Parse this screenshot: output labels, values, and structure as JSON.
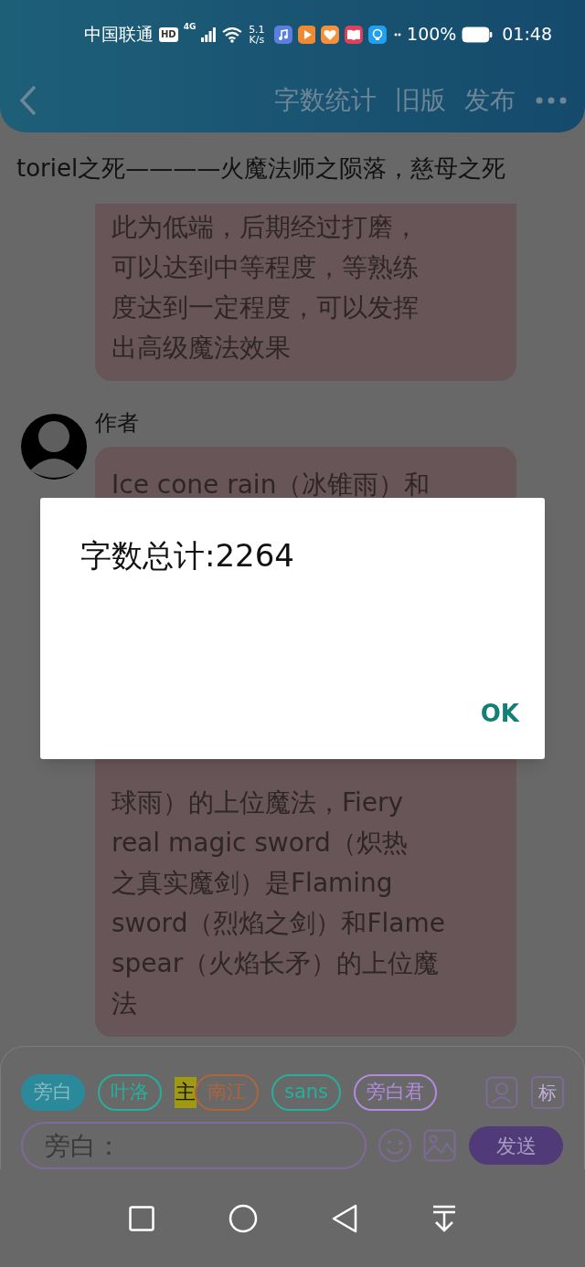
{
  "status_bar": {
    "carrier": "中国联通",
    "hd": "HD",
    "network": "4G",
    "speed_value": "5.1",
    "speed_unit": "K/s",
    "battery": "100%",
    "time": "01:48"
  },
  "header": {
    "actions": [
      "字数统计",
      "旧版",
      "发布"
    ]
  },
  "story_title": "toriel之死————火魔法师之陨落，慈母之死",
  "messages": [
    {
      "lines_before": [
        "此为低端，后期经过打磨，",
        "可以达到中等程度，等熟练",
        "度达到一定程度，可以发挥",
        "出高级魔法效果"
      ]
    },
    {
      "author": "作者",
      "lines_before": [
        "Ice cone rain（冰锥雨）和"
      ],
      "lines_after": [
        "球雨）的上位魔法，Fiery",
        "real magic sword（炽热",
        "之真实魔剑）是Flaming",
        "sword（烈焰之剑）和Flame",
        "spear（火焰长矛）的上位魔",
        "法"
      ]
    }
  ],
  "characters": [
    {
      "label": "旁白",
      "color": "#2a8a9a",
      "selected": true
    },
    {
      "label": "叶洛",
      "color": "#25b09c",
      "selected": false
    },
    {
      "label": "南江",
      "color": "#b0643a",
      "selected": false,
      "badge": "主"
    },
    {
      "label": "sans",
      "color": "#25b09c",
      "selected": false
    },
    {
      "label": "旁白君",
      "color": "#b48ae0",
      "selected": false
    }
  ],
  "tool_icons": [
    "标"
  ],
  "input": {
    "placeholder": "旁白："
  },
  "send_button": "发送",
  "dialog": {
    "message": "字数总计:2264",
    "button": "OK"
  }
}
